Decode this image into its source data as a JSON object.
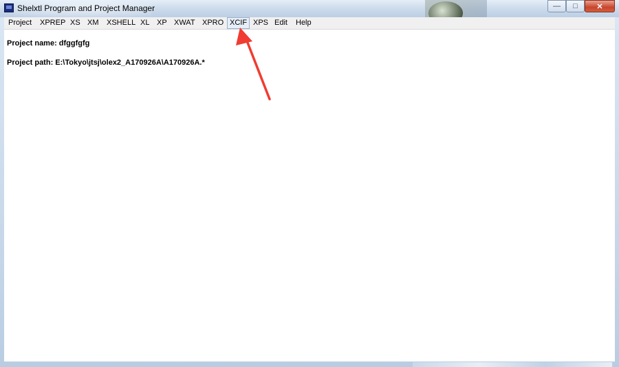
{
  "window": {
    "title": "Shelxtl Program and Project Manager",
    "accent_color": "#bccfe5",
    "close_color": "#c8452d",
    "arrow_color": "#f03c32"
  },
  "menu": {
    "items": [
      {
        "label": "Project"
      },
      {
        "label": "XPREP"
      },
      {
        "label": "XS"
      },
      {
        "label": "XM"
      },
      {
        "label": "XSHELL"
      },
      {
        "label": "XL"
      },
      {
        "label": "XP"
      },
      {
        "label": "XWAT"
      },
      {
        "label": "XPRO"
      },
      {
        "label": "XCIF"
      },
      {
        "label": "XPS"
      },
      {
        "label": "Edit"
      },
      {
        "label": "Help"
      }
    ],
    "selected": "XCIF"
  },
  "content": {
    "project_name": "Project name: dfggfgfg",
    "project_path": "Project path: E:\\Tokyo\\jtsj\\olex2_A170926A\\A170926A.*"
  }
}
